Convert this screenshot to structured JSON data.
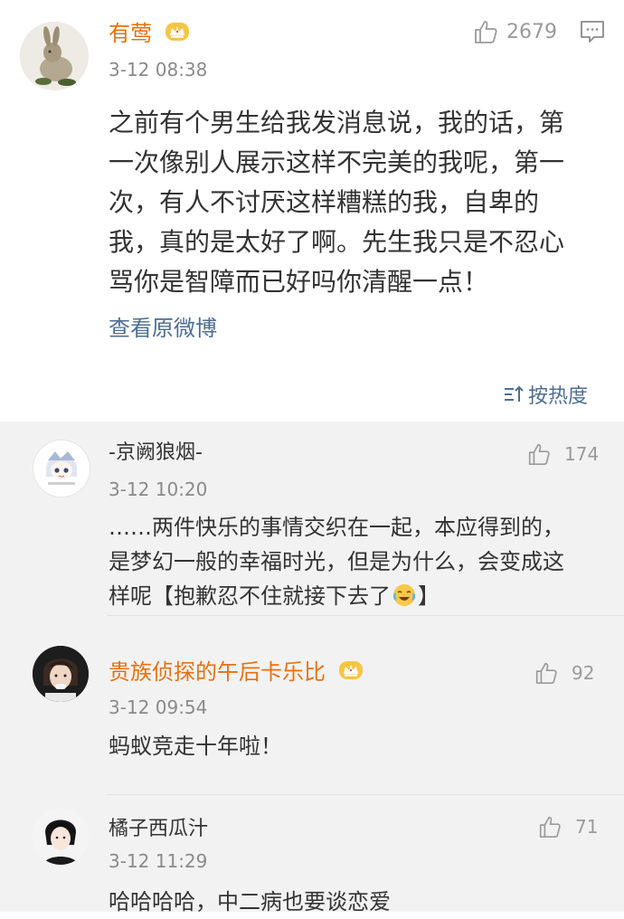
{
  "main_comment": {
    "username": "有莺",
    "time": "3-12 08:38",
    "likes": "2679",
    "text": "之前有个男生给我发消息说，我的话，第一次像别人展示这样不完美的我呢，第一次，有人不讨厌这样糟糕的我，自卑的我，真的是太好了啊。先生我只是不忍心骂你是智障而已好吗你清醒一点！",
    "view_original": "查看原微博",
    "sort_label": "按热度"
  },
  "replies": [
    {
      "username": "-京阙狼烟-",
      "time": "3-12 10:20",
      "likes": "174",
      "text_before": "……两件快乐的事情交织在一起，本应得到的，是梦幻一般的幸福时光，但是为什么，会变成这样呢【抱歉忍不住就接下去了",
      "text_after": "】"
    },
    {
      "username": "贵族侦探的午后卡乐比",
      "time": "3-12 09:54",
      "likes": "92",
      "text": "蚂蚁竞走十年啦！"
    },
    {
      "username": "橘子西瓜汁",
      "time": "3-12 11:29",
      "likes": "71",
      "text": "哈哈哈哈，中二病也要谈恋爱"
    }
  ],
  "colors": {
    "vip_name": "#e8710f",
    "link": "#4d6e92",
    "reply_bg": "#f2f2f2"
  },
  "icons": [
    "thumbs-up-icon",
    "comment-icon",
    "crown-vip-icon",
    "sort-icon",
    "laugh-cry-emoji"
  ]
}
